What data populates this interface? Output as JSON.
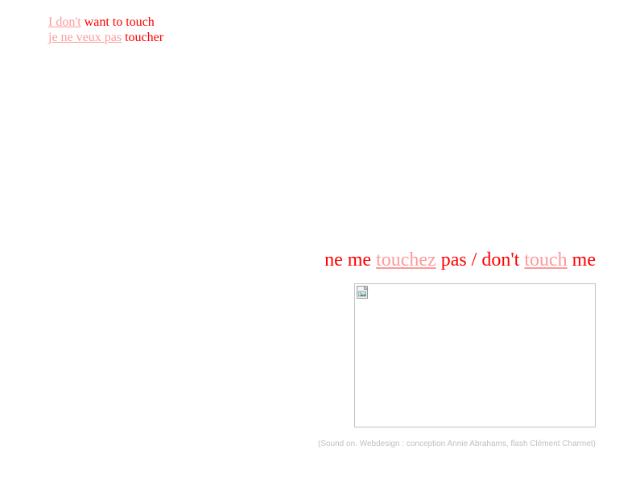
{
  "top": {
    "line1": {
      "link": "I don't",
      "rest": " want to touch"
    },
    "line2": {
      "link": "je ne veux pas",
      "rest": " toucher"
    }
  },
  "headline": {
    "part1": "ne me ",
    "link1": "touchez",
    "part2": " pas / don't ",
    "link2": "touch",
    "part3": " me"
  },
  "image": {
    "icon": "broken-image-icon"
  },
  "credits": "(Sound on. Webdesign : conception Annie Abrahams, flash Clément Charmet)",
  "colors": {
    "text": "#ff0000",
    "link": "#ff9999",
    "credits": "#c0c0c0",
    "border": "#c0c0c0"
  }
}
